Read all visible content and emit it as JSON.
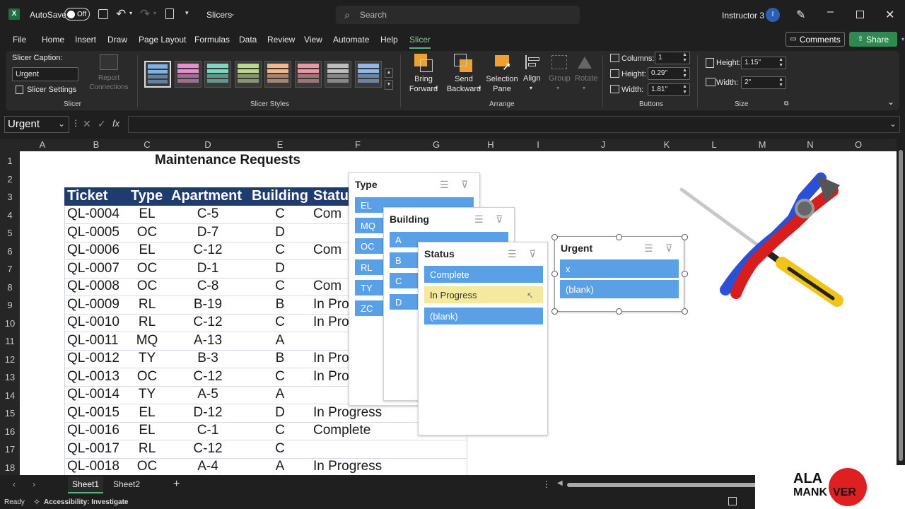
{
  "titlebar": {
    "autosave_label": "AutoSave",
    "autosave_state": "Off",
    "file_name": "Slicers",
    "search_placeholder": "Search",
    "user_name": "Instructor 3",
    "user_initial": "I"
  },
  "menu": {
    "items": [
      "File",
      "Home",
      "Insert",
      "Draw",
      "Page Layout",
      "Formulas",
      "Data",
      "Review",
      "View",
      "Automate",
      "Help",
      "Slicer"
    ],
    "active": "Slicer",
    "comments_label": "Comments",
    "share_label": "Share"
  },
  "ribbon": {
    "slicer_caption_label": "Slicer Caption:",
    "slicer_caption_value": "Urgent",
    "slicer_settings_label": "Slicer Settings",
    "report_connections_label": "Report Connections",
    "group_slicer": "Slicer",
    "group_styles": "Slicer Styles",
    "bring_forward": "Bring Forward",
    "send_backward": "Send Backward",
    "selection_pane": "Selection Pane",
    "align": "Align",
    "group": "Group",
    "rotate": "Rotate",
    "group_arrange": "Arrange",
    "columns_label": "Columns:",
    "columns_value": "1",
    "btn_height_label": "Height:",
    "btn_height_value": "0.29\"",
    "btn_width_label": "Width:",
    "btn_width_value": "1.81\"",
    "group_buttons": "Buttons",
    "size_height_label": "Height:",
    "size_height_value": "1.15\"",
    "size_width_label": "Width:",
    "size_width_value": "2\"",
    "group_size": "Size",
    "style_colors": [
      "#7eb3e6",
      "#e58fd1",
      "#7fd6c2",
      "#b6d98c",
      "#f2b88c",
      "#e89aa0",
      "#bdbdbd",
      "#8fb7e8"
    ]
  },
  "formula_bar": {
    "name_box": "Urgent",
    "fx": "fx",
    "content": ""
  },
  "grid": {
    "columns": [
      "A",
      "B",
      "C",
      "D",
      "E",
      "F",
      "G",
      "H",
      "I",
      "J",
      "K",
      "L",
      "M",
      "N",
      "O"
    ],
    "rows": [
      "1",
      "2",
      "3",
      "4",
      "5",
      "6",
      "7",
      "8",
      "9",
      "10",
      "11",
      "12",
      "13",
      "14",
      "15",
      "16",
      "17",
      "18"
    ]
  },
  "sheet_title": "Maintenance Requests",
  "table": {
    "headers": [
      "Ticket",
      "Type",
      "Apartment",
      "Building",
      "Status"
    ],
    "rows": [
      [
        "QL-0004",
        "EL",
        "C-5",
        "C",
        "Com"
      ],
      [
        "QL-0005",
        "OC",
        "D-7",
        "D",
        ""
      ],
      [
        "QL-0006",
        "EL",
        "C-12",
        "C",
        "Com"
      ],
      [
        "QL-0007",
        "OC",
        "D-1",
        "D",
        ""
      ],
      [
        "QL-0008",
        "OC",
        "C-8",
        "C",
        "Com"
      ],
      [
        "QL-0009",
        "RL",
        "B-19",
        "B",
        "In Progr"
      ],
      [
        "QL-0010",
        "RL",
        "C-12",
        "C",
        "In Pro"
      ],
      [
        "QL-0011",
        "MQ",
        "A-13",
        "A",
        ""
      ],
      [
        "QL-0012",
        "TY",
        "B-3",
        "B",
        "In Pro"
      ],
      [
        "QL-0013",
        "OC",
        "C-12",
        "C",
        "In Progress"
      ],
      [
        "QL-0014",
        "TY",
        "A-5",
        "A",
        ""
      ],
      [
        "QL-0015",
        "EL",
        "D-12",
        "D",
        "In Progress"
      ],
      [
        "QL-0016",
        "EL",
        "C-1",
        "C",
        "Complete"
      ],
      [
        "QL-0017",
        "RL",
        "C-12",
        "C",
        ""
      ],
      [
        "QL-0018",
        "OC",
        "A-4",
        "A",
        "In Progress"
      ]
    ]
  },
  "slicers": {
    "type": {
      "title": "Type",
      "items": [
        "EL",
        "MQ",
        "OC",
        "RL",
        "TY",
        "ZC"
      ]
    },
    "building": {
      "title": "Building",
      "items": [
        "A",
        "B",
        "C",
        "D"
      ]
    },
    "status": {
      "title": "Status",
      "items": [
        "Complete",
        "In Progress",
        "(blank)"
      ]
    },
    "urgent": {
      "title": "Urgent",
      "items": [
        "x",
        "(blank)"
      ]
    }
  },
  "tabs": {
    "sheets": [
      "Sheet1",
      "Sheet2"
    ],
    "active": "Sheet1",
    "add": "+"
  },
  "status_bar": {
    "ready": "Ready",
    "accessibility": "Accessibility: Investigate"
  },
  "logo": {
    "line1": "ALA",
    "line2": "MANK",
    "line3": "VER"
  }
}
